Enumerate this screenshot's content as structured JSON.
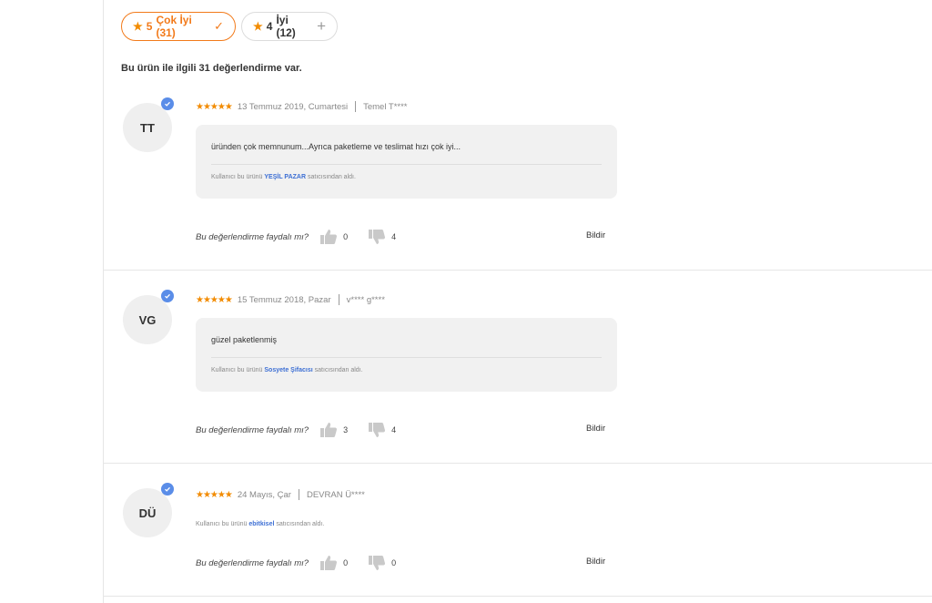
{
  "filters": [
    {
      "star": "★",
      "rating": "5",
      "label": "Çok İyi (31)",
      "mark": "✓"
    },
    {
      "star": "★",
      "rating": "4",
      "label": "İyi (12)",
      "mark": "+"
    }
  ],
  "summary": "Bu ürün ile ilgili 31 değerlendirme var.",
  "helpful_question": "Bu değerlendirme faydalı mı?",
  "report_label": "Bildir",
  "stars_glyph": "★★★★★",
  "seller_prefix": "Kullanıcı bu ürünü",
  "seller_suffix": "satıcısından aldı.",
  "reviews": [
    {
      "initials": "TT",
      "date": "13 Temmuz 2019, Cumartesi",
      "author": "Temel T****",
      "comment": "üründen çok memnunum...Ayrıca paketleme ve teslimat hızı çok iyi...",
      "seller": "YEŞİL PAZAR",
      "likes": "0",
      "dislikes": "4"
    },
    {
      "initials": "VG",
      "date": "15 Temmuz 2018, Pazar",
      "author": "v**** g****",
      "comment": "güzel paketlenmiş",
      "seller": "Sosyete Şifacısı",
      "likes": "3",
      "dislikes": "4"
    },
    {
      "initials": "DÜ",
      "date": "24 Mayıs, Çar",
      "author": "DEVRAN Ü****",
      "comment": "",
      "seller": "ebitkisel",
      "likes": "0",
      "dislikes": "0"
    }
  ],
  "colors": {
    "accent": "#f27a1a",
    "star": "#f28b00",
    "verified": "#5a8de8",
    "seller_link": "#3d6fd4"
  }
}
